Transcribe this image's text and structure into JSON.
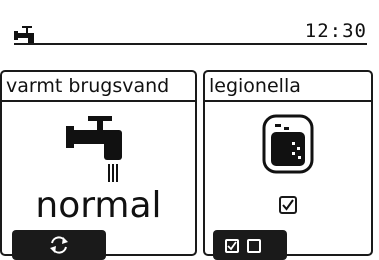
{
  "status_bar": {
    "mode_icon": "faucet-icon",
    "clock": "12:30"
  },
  "dhw_panel": {
    "title": "varmt brugsvand",
    "icon": "faucet-icon",
    "status": "normal",
    "button_icon": "cycle-arrows-icon"
  },
  "legionella_panel": {
    "title": "legionella",
    "icon": "tank-icon",
    "checked": true,
    "buttons": [
      "checked-box-icon",
      "empty-box-icon"
    ]
  }
}
